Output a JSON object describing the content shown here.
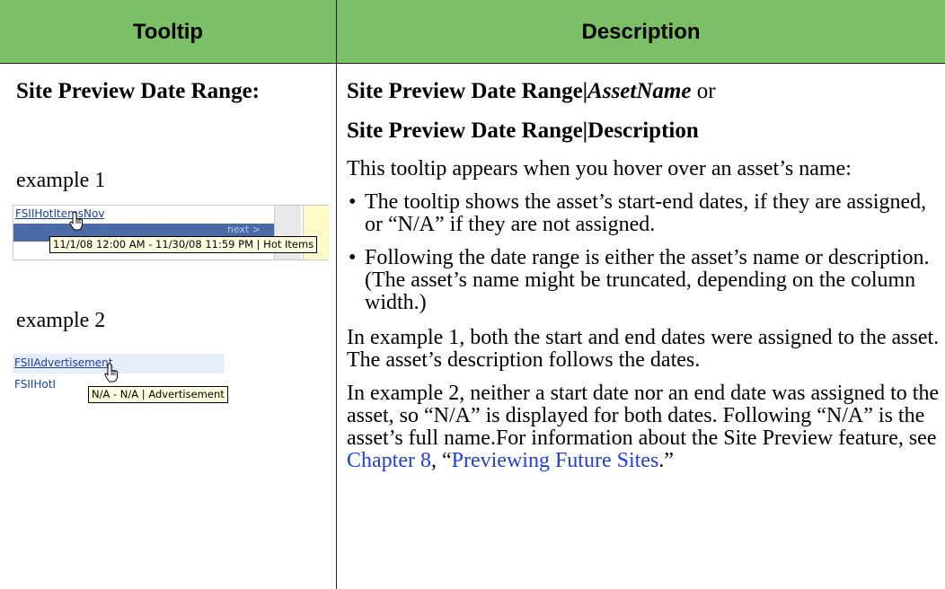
{
  "table": {
    "headers": [
      "Tooltip",
      "Description"
    ],
    "header_color": "#7bc067"
  },
  "left": {
    "heading": "Site Preview Date Range:",
    "example1_label": "example 1",
    "example2_label": "example 2"
  },
  "example1": {
    "asset_link": "FSIIHotItemsNov",
    "next_label": "next >",
    "tooltip": "11/1/08 12:00 AM - 11/30/08 11:59 PM | Hot Items"
  },
  "example2": {
    "asset_link_1": "FSIIAdvertisement",
    "asset_link_2": "FSIIHotI",
    "tooltip": "N/A - N/A | Advertisement"
  },
  "right": {
    "heading1_bold": "Site Preview Date Range|",
    "heading1_italic": "AssetName",
    "heading1_or": " or",
    "heading2": "Site Preview Date Range|Description",
    "intro": "This tooltip appears when you hover over an asset’s name:",
    "bullets": [
      "The tooltip shows the asset’s start-end dates, if they are assigned, or “N/A” if they are not assigned.",
      "Following the date range is either the asset’s name or description. (The asset’s name might be truncated, depending on the column width.)"
    ],
    "para1": "In example 1, both the start and end dates were assigned to the asset. The asset’s description follows the dates.",
    "para2": "In example 2, neither a start date nor an end date was assigned to the asset, so “N/A” is displayed for both dates. Following “N/A” is the asset’s full name.For information about the Site Preview feature, see",
    "chapter_link": "Chapter 8",
    "sep": ", “",
    "section_link": "Previewing Future Sites",
    "end": ".”"
  }
}
